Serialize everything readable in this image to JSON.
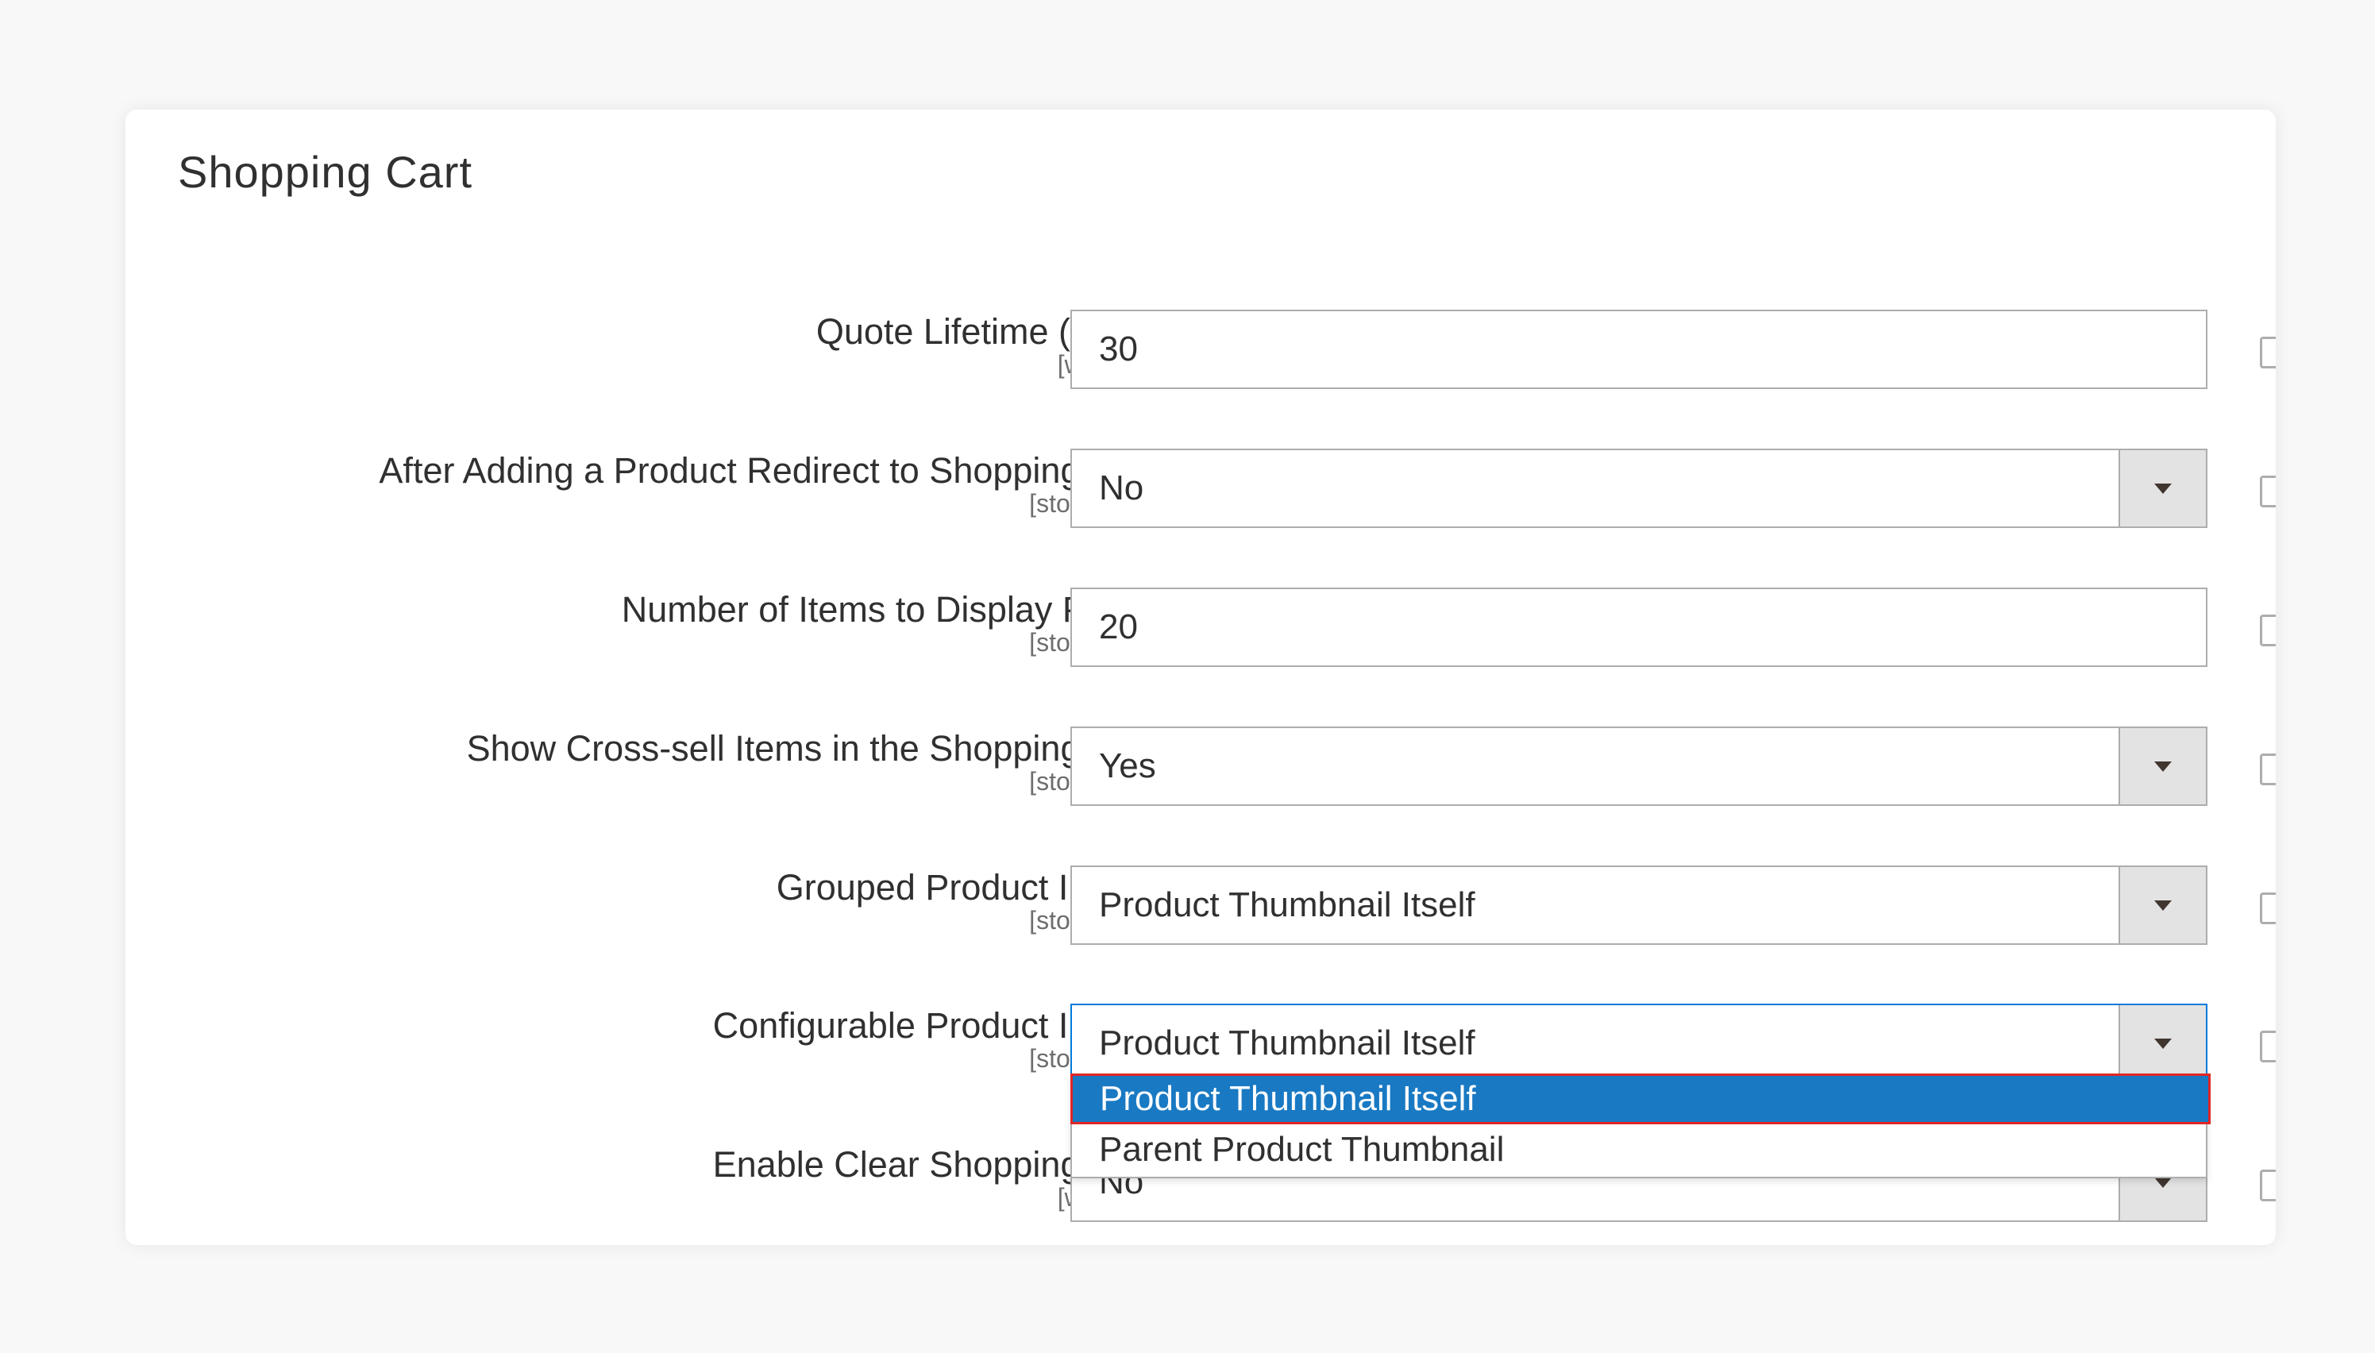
{
  "panel": {
    "title": "Shopping Cart"
  },
  "fields": [
    {
      "label": "Quote Lifetime (days)",
      "scope": "[website]",
      "value": "30",
      "type": "text"
    },
    {
      "label": "After Adding a Product Redirect to Shopping Cart",
      "scope": "[store view]",
      "value": "No",
      "type": "select"
    },
    {
      "label": "Number of Items to Display Pager",
      "scope": "[store view]",
      "value": "20",
      "type": "text"
    },
    {
      "label": "Show Cross-sell Items in the Shopping Cart",
      "scope": "[store view]",
      "value": "Yes",
      "type": "select"
    },
    {
      "label": "Grouped Product Image",
      "scope": "[store view]",
      "value": "Product Thumbnail Itself",
      "type": "select"
    },
    {
      "label": "Configurable Product Image",
      "scope": "[store view]",
      "value": "Product Thumbnail Itself",
      "type": "select",
      "focused": true
    },
    {
      "label": "Enable Clear Shopping Cart",
      "scope": "[website]",
      "value": "No",
      "type": "select"
    }
  ],
  "open_dropdown": {
    "options": [
      "Product Thumbnail Itself",
      "Parent Product Thumbnail"
    ],
    "selected_index": 0
  },
  "colors": {
    "focus_border": "#007bdb",
    "selected_option_bg": "#1979c3",
    "highlight_outline": "#e22626"
  }
}
